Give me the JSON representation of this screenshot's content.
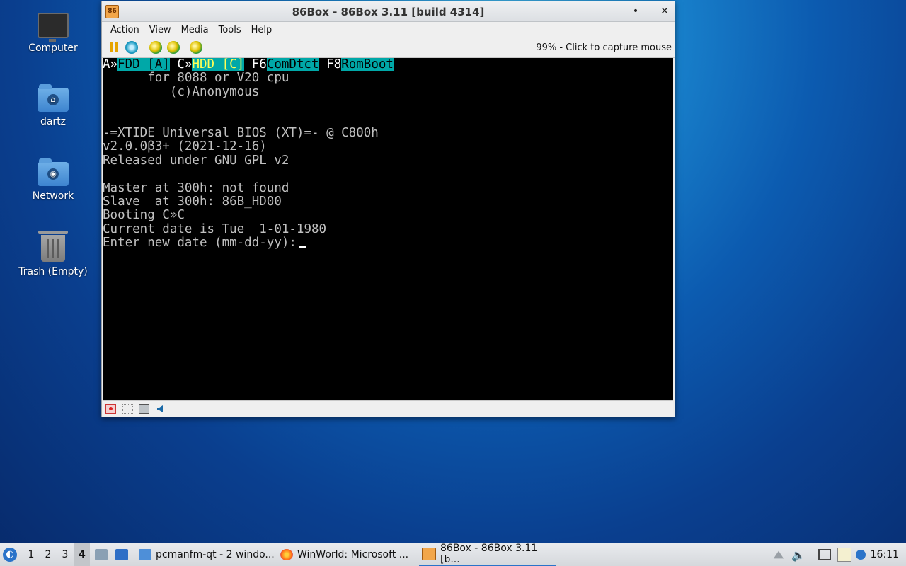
{
  "desktop": {
    "icons": [
      {
        "label": "Computer",
        "icon": "computer-icon"
      },
      {
        "label": "dartz",
        "icon": "home-folder-icon"
      },
      {
        "label": "Network",
        "icon": "network-folder-icon"
      },
      {
        "label": "Trash (Empty)",
        "icon": "trash-icon"
      }
    ]
  },
  "window": {
    "title": "86Box - 86Box 3.11 [build 4314]",
    "minimize_glyph": "•",
    "close_glyph": "✕",
    "menu": [
      "Action",
      "View",
      "Media",
      "Tools",
      "Help"
    ],
    "toolbar": {
      "buttons": [
        "pause-icon",
        "hard-reset-icon",
        "ctrl-alt-del-icon",
        "ctrl-alt-esc-icon",
        "settings-icon"
      ],
      "status": "99% - Click to capture mouse"
    },
    "screen": {
      "header": {
        "a_prefix": "A»",
        "a_label": "FDD [A]",
        "c_prefix": " C»",
        "c_label": "HDD [C]",
        "f6": " F6",
        "f6_label": "ComDtct",
        "f8": " F8",
        "f8_label": "RomBoot"
      },
      "lines": [
        "      for 8088 or V20 cpu",
        "         (c)Anonymous",
        "",
        "",
        "-=XTIDE Universal BIOS (XT)=- @ C800h",
        "v2.0.0β3+ (2021-12-16)",
        "Released under GNU GPL v2",
        "",
        "Master at 300h: not found",
        "Slave  at 300h: 86B_HD00",
        "Booting C»C",
        "Current date is Tue  1-01-1980",
        "Enter new date (mm-dd-yy):"
      ]
    },
    "statusbar": [
      "floppy-icon",
      "cdrom-icon",
      "hdd-icon",
      "network-icon"
    ]
  },
  "taskbar": {
    "workspaces": [
      "1",
      "2",
      "3",
      "4"
    ],
    "active_workspace": "4",
    "tasks": [
      {
        "label": "pcmanfm-qt - 2 windo...",
        "icon": "folder-icon"
      },
      {
        "label": "WinWorld: Microsoft ...",
        "icon": "firefox-icon"
      },
      {
        "label": "86Box - 86Box 3.11 [b...",
        "icon": "86box-icon"
      }
    ],
    "clock": "16:11"
  },
  "colors": {
    "accent": "#2a73c9",
    "cga_cyan": "#00a8a8",
    "cga_yellow": "#ffff55",
    "cga_gray": "#c0c0c0"
  }
}
